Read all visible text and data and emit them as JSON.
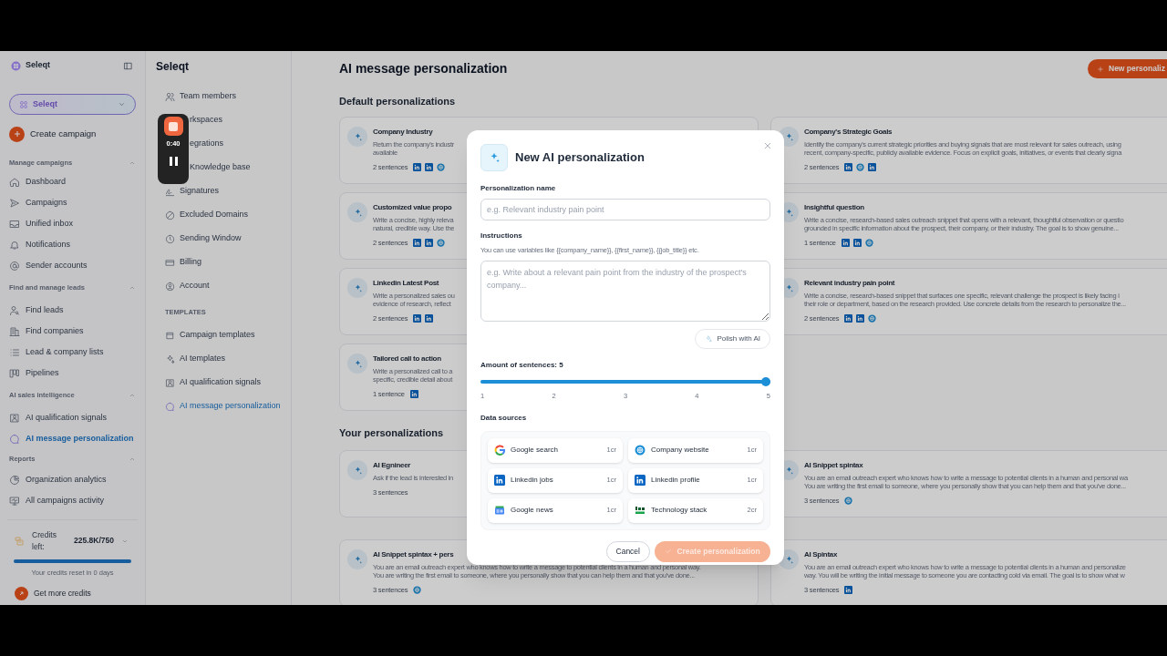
{
  "recorder": {
    "time": "0:40"
  },
  "sidebar": {
    "brand": "Seleqt",
    "workspace": "Seleqt",
    "create_button": "Create campaign",
    "sections": [
      {
        "title": "Manage campaigns",
        "expanded": true,
        "items": [
          {
            "label": "Dashboard",
            "selected": false
          },
          {
            "label": "Campaigns",
            "selected": false
          },
          {
            "label": "Unified inbox",
            "selected": false
          },
          {
            "label": "Notifications",
            "selected": false
          },
          {
            "label": "Sender accounts",
            "selected": false
          }
        ]
      },
      {
        "title": "Find and manage leads",
        "expanded": true,
        "items": [
          {
            "label": "Find leads",
            "selected": false
          },
          {
            "label": "Find companies",
            "selected": false
          },
          {
            "label": "Lead & company lists",
            "selected": false
          },
          {
            "label": "Pipelines",
            "selected": false
          }
        ]
      },
      {
        "title": "AI sales intelligence",
        "expanded": true,
        "items": [
          {
            "label": "AI qualification signals",
            "selected": false
          },
          {
            "label": "AI message personalization",
            "selected": true
          }
        ]
      },
      {
        "title": "Reports",
        "expanded": true,
        "items": [
          {
            "label": "Organization analytics",
            "selected": false
          },
          {
            "label": "All campaigns activity",
            "selected": false
          }
        ]
      }
    ],
    "credits": {
      "label": "Credits left:",
      "value": "225.8K/750",
      "level": 1,
      "reset_note": "Your credits reset in 0 days",
      "cta": "Get more credits"
    }
  },
  "settings_nav": {
    "title": "Seleqt",
    "items": [
      {
        "label": "Team members",
        "selected": false,
        "covered": false
      },
      {
        "label": "rkspaces",
        "selected": false,
        "covered": true
      },
      {
        "label": "egrations",
        "selected": false,
        "covered": true
      },
      {
        "label": "Knowledge base",
        "selected": false,
        "covered": true
      },
      {
        "label": "Signatures",
        "selected": false,
        "covered": false
      },
      {
        "label": "Excluded Domains",
        "selected": false,
        "covered": false
      },
      {
        "label": "Sending Window",
        "selected": false,
        "covered": false
      },
      {
        "label": "Billing",
        "selected": false,
        "covered": false
      },
      {
        "label": "Account",
        "selected": false,
        "covered": false
      }
    ],
    "templates_heading": "TEMPLATES",
    "template_items": [
      {
        "label": "Campaign templates",
        "selected": false
      },
      {
        "label": "AI templates",
        "selected": false
      },
      {
        "label": "AI qualification signals",
        "selected": false
      },
      {
        "label": "AI message personalization",
        "selected": true
      }
    ]
  },
  "main": {
    "title": "AI message personalization",
    "new_button": "New personaliz",
    "default_heading": "Default personalizations",
    "default_cards": [
      {
        "title": "Company Industry",
        "description": "Return the company's industr\navailable",
        "sentences": "2 sentences",
        "sources": [
          {
            "kind": "linkedin"
          },
          {
            "kind": "linkedin"
          },
          {
            "kind": "web"
          }
        ]
      },
      {
        "title": "Company's Strategic Goals",
        "description": "Identify the company's current strategic priorities and buying signals that are most relevant for sales outreach, using\nrecent, company-specific, publicly available evidence. Focus on explicit goals, initiatives, or events that clearly signa",
        "sentences": "2 sentences",
        "sources": [
          {
            "kind": "linkedin"
          },
          {
            "kind": "web"
          },
          {
            "kind": "linkedin"
          }
        ]
      },
      {
        "title": "Customized value propo",
        "description": "Write a concise, highly releva\nnatural, credible way. Use the",
        "sentences": "2 sentences",
        "sources": [
          {
            "kind": "linkedin"
          },
          {
            "kind": "linkedin"
          },
          {
            "kind": "web"
          }
        ]
      },
      {
        "title": "Insightful question",
        "description": "Write a concise, research-based sales outreach snippet that opens with a relevant, thoughtful observation or questio\ngrounded in specific information about the prospect, their company, or their industry. The goal is to show genuine...",
        "sentences": "1 sentence",
        "sources": [
          {
            "kind": "linkedin"
          },
          {
            "kind": "linkedin"
          },
          {
            "kind": "web"
          }
        ]
      },
      {
        "title": "Linkedin Latest Post",
        "description": "Write a personalized sales ou\nevidence of research, reflect",
        "sentences": "2 sentences",
        "sources": [
          {
            "kind": "linkedin"
          },
          {
            "kind": "linkedin"
          }
        ]
      },
      {
        "title": "Relevant industry pain point",
        "description": "Write a concise, research-based snippet that surfaces one specific, relevant challenge the prospect is likely facing i\ntheir role or department, based on the research provided. Use concrete details from the research to personalize the...",
        "sentences": "2 sentences",
        "sources": [
          {
            "kind": "linkedin"
          },
          {
            "kind": "linkedin"
          },
          {
            "kind": "web"
          }
        ]
      },
      {
        "title": "Tailored call to action",
        "description": "Write a personalized call to a\nspecific, credible detail about",
        "sentences": "1 sentence",
        "sources": [
          {
            "kind": "linkedin"
          }
        ]
      }
    ],
    "your_heading": "Your personalizations",
    "your_cards": [
      {
        "title": "AI Egnineer",
        "description": "Ask if the lead is interested in",
        "sentences": "3 sentences"
      },
      {
        "title": "AI Snippet spintax",
        "description": "You are an email outreach expert who knows how to write a message to potential clients in a human and personal wa\nYou are writing the first email to someone, where you personally show that you can help them and that you've done...",
        "sentences": "3 sentences",
        "sources": [
          {
            "kind": "web"
          }
        ]
      },
      {
        "title": "AI Snippet spintax + pers",
        "description": "You are an email outreach expert who knows how to write a message to potential clients in a human and personal way.\nYou are writing the first email to someone, where you personally show that you can help them and that you've done...",
        "sentences": "3 sentences",
        "sources": [
          {
            "kind": "web"
          }
        ]
      },
      {
        "title": "AI Spintax",
        "description": "You are an email outreach expert who knows how to write a message to potential clients in a human and personalize\nway. You will be writing the initial message to someone you are contacting cold via email. The goal is to show what w",
        "sentences": "3 sentences",
        "sources": [
          {
            "kind": "linkedin"
          }
        ]
      }
    ]
  },
  "modal": {
    "title": "New AI personalization",
    "name_field": {
      "label": "Personalization name",
      "placeholder": "e.g. Relevant industry pain point"
    },
    "instructions": {
      "label": "Instructions",
      "hint": "You can use variables like {{company_name}}, {{first_name}}, {{job_title}} etc.",
      "placeholder": "e.g. Write about a relevant pain point from the industry of the prospect's company..."
    },
    "polish_button": "Polish with AI",
    "sentences": {
      "label": "Amount of sentences: 5",
      "level": 1,
      "ticks": [
        "1",
        "2",
        "3",
        "4",
        "5"
      ]
    },
    "data_sources": {
      "label": "Data sources",
      "items": [
        {
          "kind": "google",
          "label": "Google search",
          "cost": "1cr"
        },
        {
          "kind": "web",
          "label": "Company website",
          "cost": "1cr"
        },
        {
          "kind": "linkedin",
          "label": "Linkedin jobs",
          "cost": "1cr"
        },
        {
          "kind": "linkedin",
          "label": "Linkedin profile",
          "cost": "1cr"
        },
        {
          "kind": "news",
          "label": "Google news",
          "cost": "1cr"
        },
        {
          "kind": "techstack",
          "label": "Technology stack",
          "cost": "2cr"
        }
      ]
    },
    "cancel_button": "Cancel",
    "create_button": {
      "label": "Create personalization",
      "disabled": true
    }
  }
}
